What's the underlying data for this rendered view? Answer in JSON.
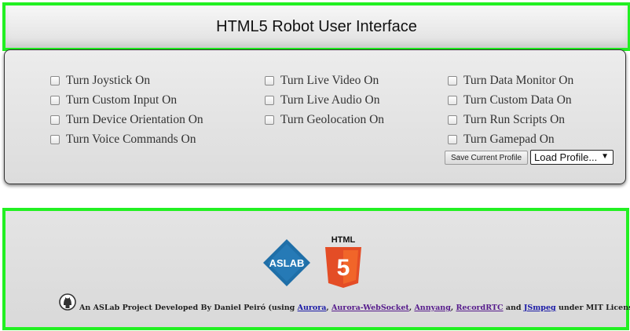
{
  "header": {
    "title": "HTML5 Robot User Interface"
  },
  "options": {
    "col1": [
      "Turn Joystick On",
      "Turn Custom Input On",
      "Turn Device Orientation On",
      "Turn Voice Commands On"
    ],
    "col2": [
      "Turn Live Video On",
      "Turn Live Audio On",
      "Turn Geolocation On"
    ],
    "col3": [
      "Turn Data Monitor On",
      "Turn Custom Data On",
      "Turn Run Scripts On",
      "Turn Gamepad On"
    ]
  },
  "profile": {
    "save_label": "Save Current Profile",
    "load_label": "Load Profile...",
    "arrow": "▼"
  },
  "logos": {
    "aslab_text": "ASLAB",
    "html5_text": "HTML",
    "html5_number": "5"
  },
  "footer": {
    "prefix": "An ASLab Project Developed By Daniel Peiró (using ",
    "links": [
      "Aurora",
      "Aurora-WebSocket",
      "Annyang",
      "RecordRTC",
      "JSmpeg"
    ],
    "sep": ", ",
    "and": " and ",
    "suffix": " under MIT License)"
  },
  "colors": {
    "highlight_border": "#22f022",
    "html5_orange": "#e44d26",
    "aslab_blue": "#1f6fa8"
  },
  "icons": {
    "github": "github-icon"
  }
}
